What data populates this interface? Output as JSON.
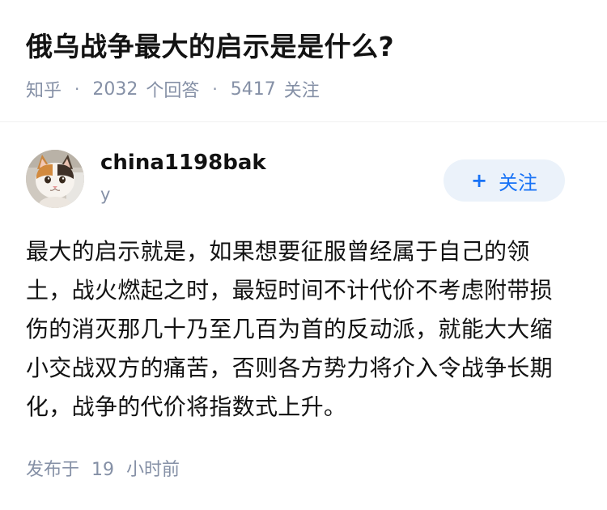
{
  "question": {
    "title": "俄乌战争最大的启示是是什么?",
    "source": "知乎",
    "answer_count": "2032",
    "answer_label": "个回答",
    "follower_count": "5417",
    "follower_label": "关注",
    "separator": "·"
  },
  "author": {
    "name": "china1198bak",
    "bio": "y",
    "avatar_icon": "cat-avatar",
    "follow_plus": "+",
    "follow_label": "关注"
  },
  "answer": {
    "text": "最大的启示就是，如果想要征服曾经属于自己的领土，战火燃起之时，最短时间不计代价不考虑附带损伤的消灭那几十乃至几百为首的反动派，就能大大缩小交战双方的痛苦，否则各方势力将介入令战争长期化，战争的代价将指数式上升。",
    "time_prefix": "发布于",
    "time_value": "19",
    "time_suffix": "小时前"
  },
  "colors": {
    "text_primary": "#121212",
    "text_secondary": "#8590a6",
    "accent": "#1772f6",
    "follow_bg": "#ebf2fa"
  }
}
